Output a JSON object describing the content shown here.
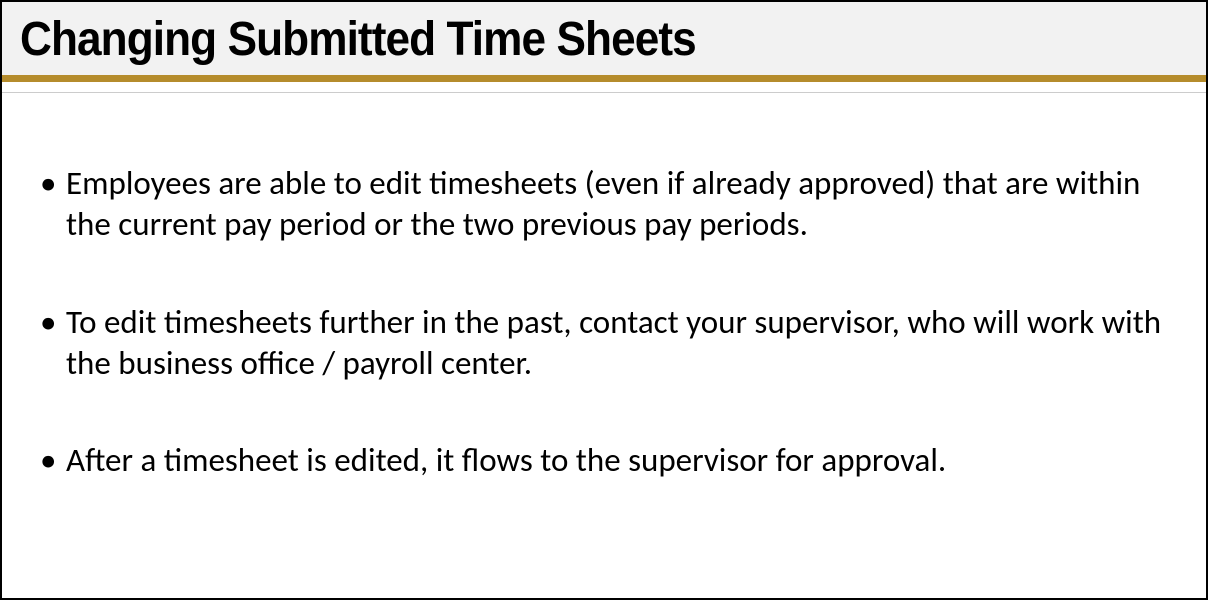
{
  "slide": {
    "title": "Changing Submitted Time Sheets",
    "bullets": [
      "Employees are able to edit timesheets (even if already approved) that are within the current pay period or the two previous pay periods.",
      "To edit timesheets further in the past, contact your supervisor, who will work with the business office / payroll center.",
      "After a timesheet is edited, it flows to the supervisor for approval."
    ]
  },
  "colors": {
    "headerBg": "#f2f2f2",
    "accent": "#b58c2c",
    "text": "#000000"
  }
}
